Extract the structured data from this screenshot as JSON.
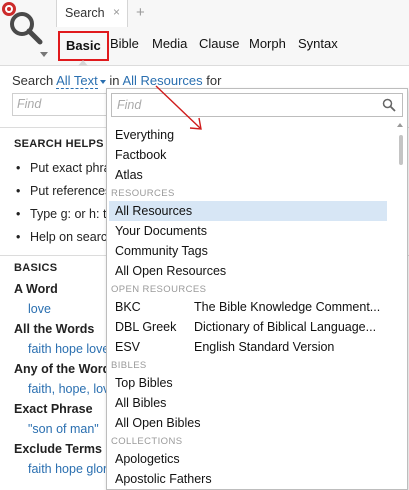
{
  "tab": {
    "label": "Search",
    "close": "×",
    "add": "+"
  },
  "modes": [
    "Basic",
    "Bible",
    "Media",
    "Clause",
    "Morph",
    "Syntax"
  ],
  "search_line": {
    "prefix": "Search",
    "scope": "All Text",
    "in_word": "in",
    "resources": "All Resources",
    "suffix": "for"
  },
  "left_find": {
    "placeholder": "Find"
  },
  "search_helps": {
    "title": "SEARCH HELPS",
    "items": [
      "Put exact phra",
      "Put references",
      "Type g: or h: t",
      "Help on search"
    ]
  },
  "basics": {
    "title": "BASICS",
    "entries": [
      {
        "label": "A Word",
        "example": "love"
      },
      {
        "label": "All the Words",
        "example": "faith hope love"
      },
      {
        "label": "Any of the Words",
        "example": "faith, hope, lov"
      },
      {
        "label": "Exact Phrase",
        "example": "\"son of man\""
      },
      {
        "label": "Exclude Terms",
        "example": "faith hope glor"
      }
    ]
  },
  "dropdown": {
    "find_placeholder": "Find",
    "top_items": [
      "Everything",
      "Factbook",
      "Atlas"
    ],
    "resources_header": "RESOURCES",
    "resources": [
      "All Resources",
      "Your Documents",
      "Community Tags",
      "All Open Resources"
    ],
    "selected": "All Resources",
    "open_resources_header": "OPEN RESOURCES",
    "open_resources": [
      {
        "abbr": "BKC",
        "title": "The Bible Knowledge Comment..."
      },
      {
        "abbr": "DBL Greek",
        "title": "Dictionary of Biblical Language..."
      },
      {
        "abbr": "ESV",
        "title": "English Standard Version"
      }
    ],
    "bibles_header": "BIBLES",
    "bibles": [
      "Top Bibles",
      "All Bibles",
      "All Open Bibles"
    ],
    "collections_header": "COLLECTIONS",
    "collections": [
      "Apologetics",
      "Apostolic Fathers"
    ]
  },
  "colors": {
    "link": "#2a6fb0",
    "highlight_box": "#e0191c",
    "selected_row": "#d7e6f5",
    "logo_red": "#cc2b2b"
  },
  "icons": [
    "target-icon",
    "search-icon",
    "chevron-down-icon",
    "close-icon",
    "plus-icon",
    "magnifier-icon",
    "arrow-annotation-icon"
  ]
}
